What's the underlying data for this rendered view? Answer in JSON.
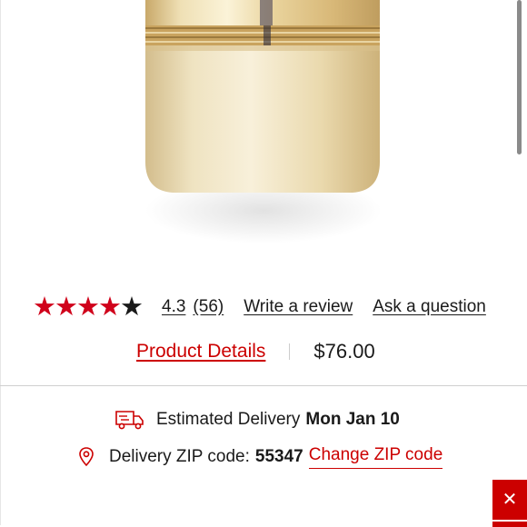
{
  "product": {
    "image_icon": "gold-cosmetic-bottle-icon"
  },
  "rating": {
    "value": "4.3",
    "count": "(56)",
    "stars_filled": 4,
    "stars_total": 5,
    "write_review_label": "Write a review",
    "ask_question_label": "Ask a question"
  },
  "details": {
    "product_details_label": "Product Details",
    "price": "$76.00"
  },
  "delivery": {
    "icon": "delivery-truck-icon",
    "label": "Estimated Delivery",
    "date": "Mon Jan 10"
  },
  "zip": {
    "icon": "location-pin-icon",
    "label": "Delivery ZIP code:",
    "value": "55347",
    "change_label": "Change ZIP code"
  },
  "close_button": {
    "icon": "close-icon"
  },
  "colors": {
    "accent_red": "#cc0000",
    "star_red": "#d0021b"
  }
}
